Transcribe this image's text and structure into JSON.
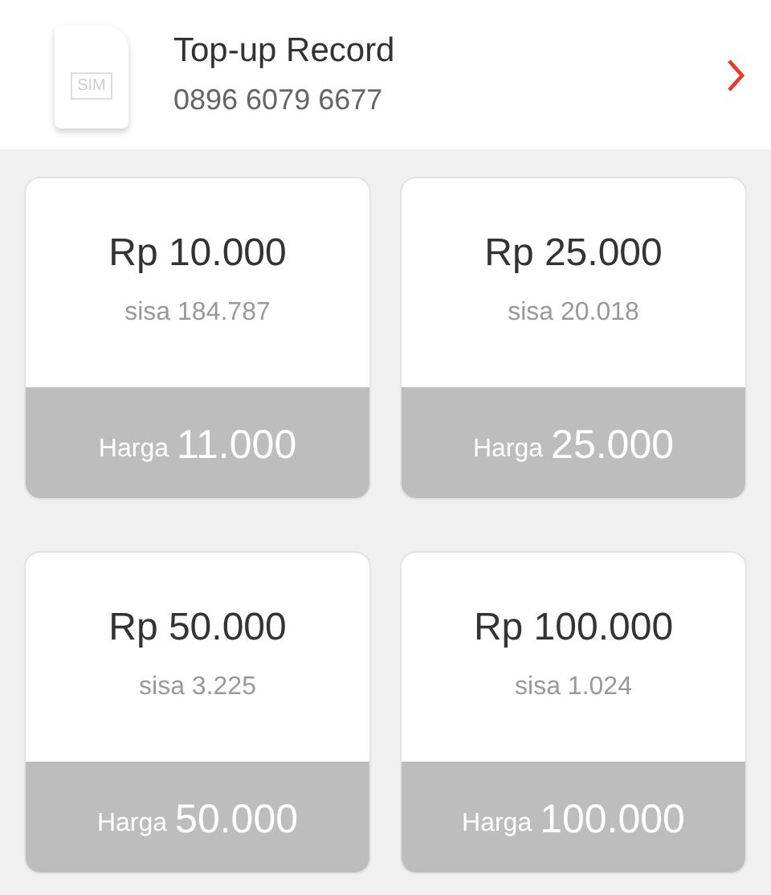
{
  "header": {
    "sim_label": "SIM",
    "title": "Top-up Record",
    "phone": "0896 6079 6677"
  },
  "packages": [
    {
      "amount": "Rp 10.000",
      "remaining": "sisa 184.787",
      "price_label": "Harga",
      "price": "11.000"
    },
    {
      "amount": "Rp 25.000",
      "remaining": "sisa 20.018",
      "price_label": "Harga",
      "price": "25.000"
    },
    {
      "amount": "Rp 50.000",
      "remaining": "sisa 3.225",
      "price_label": "Harga",
      "price": "50.000"
    },
    {
      "amount": "Rp 100.000",
      "remaining": "sisa 1.024",
      "price_label": "Harga",
      "price": "100.000"
    }
  ]
}
